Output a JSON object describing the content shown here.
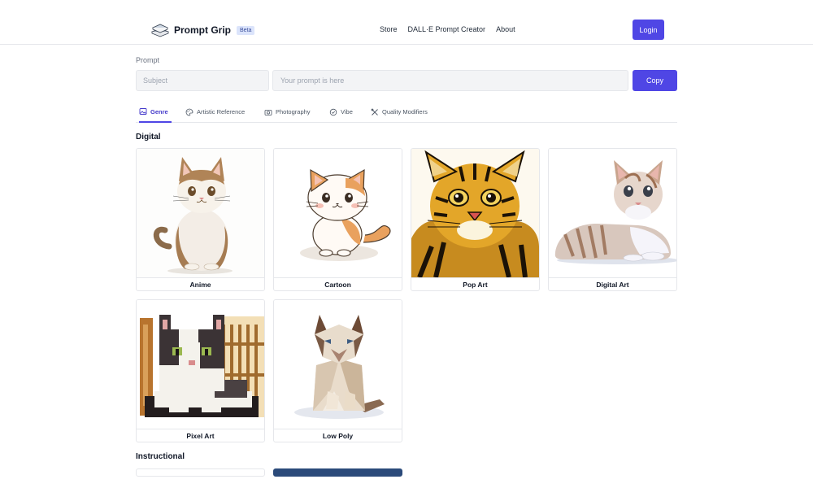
{
  "header": {
    "brand": "Prompt Grip",
    "badge": "Beta",
    "nav": [
      "Store",
      "DALL·E Prompt Creator",
      "About"
    ],
    "login_label": "Login"
  },
  "prompt": {
    "label": "Prompt",
    "subject_placeholder": "Subject",
    "prompt_placeholder": "Your prompt is here",
    "copy_label": "Copy"
  },
  "tabs": [
    {
      "label": "Genre",
      "icon": "image-icon",
      "active": true
    },
    {
      "label": "Artistic Reference",
      "icon": "palette-icon",
      "active": false
    },
    {
      "label": "Photography",
      "icon": "camera-icon",
      "active": false
    },
    {
      "label": "Vibe",
      "icon": "check-circle-icon",
      "active": false
    },
    {
      "label": "Quality Modifiers",
      "icon": "tools-icon",
      "active": false
    }
  ],
  "sections": [
    {
      "title": "Digital",
      "cards": [
        {
          "label": "Anime"
        },
        {
          "label": "Cartoon"
        },
        {
          "label": "Pop Art"
        },
        {
          "label": "Digital Art"
        },
        {
          "label": "Pixel Art"
        },
        {
          "label": "Low Poly"
        }
      ]
    },
    {
      "title": "Instructional",
      "cards": []
    }
  ],
  "colors": {
    "accent": "#4f46e5",
    "badge_bg": "#dbe4fb"
  }
}
